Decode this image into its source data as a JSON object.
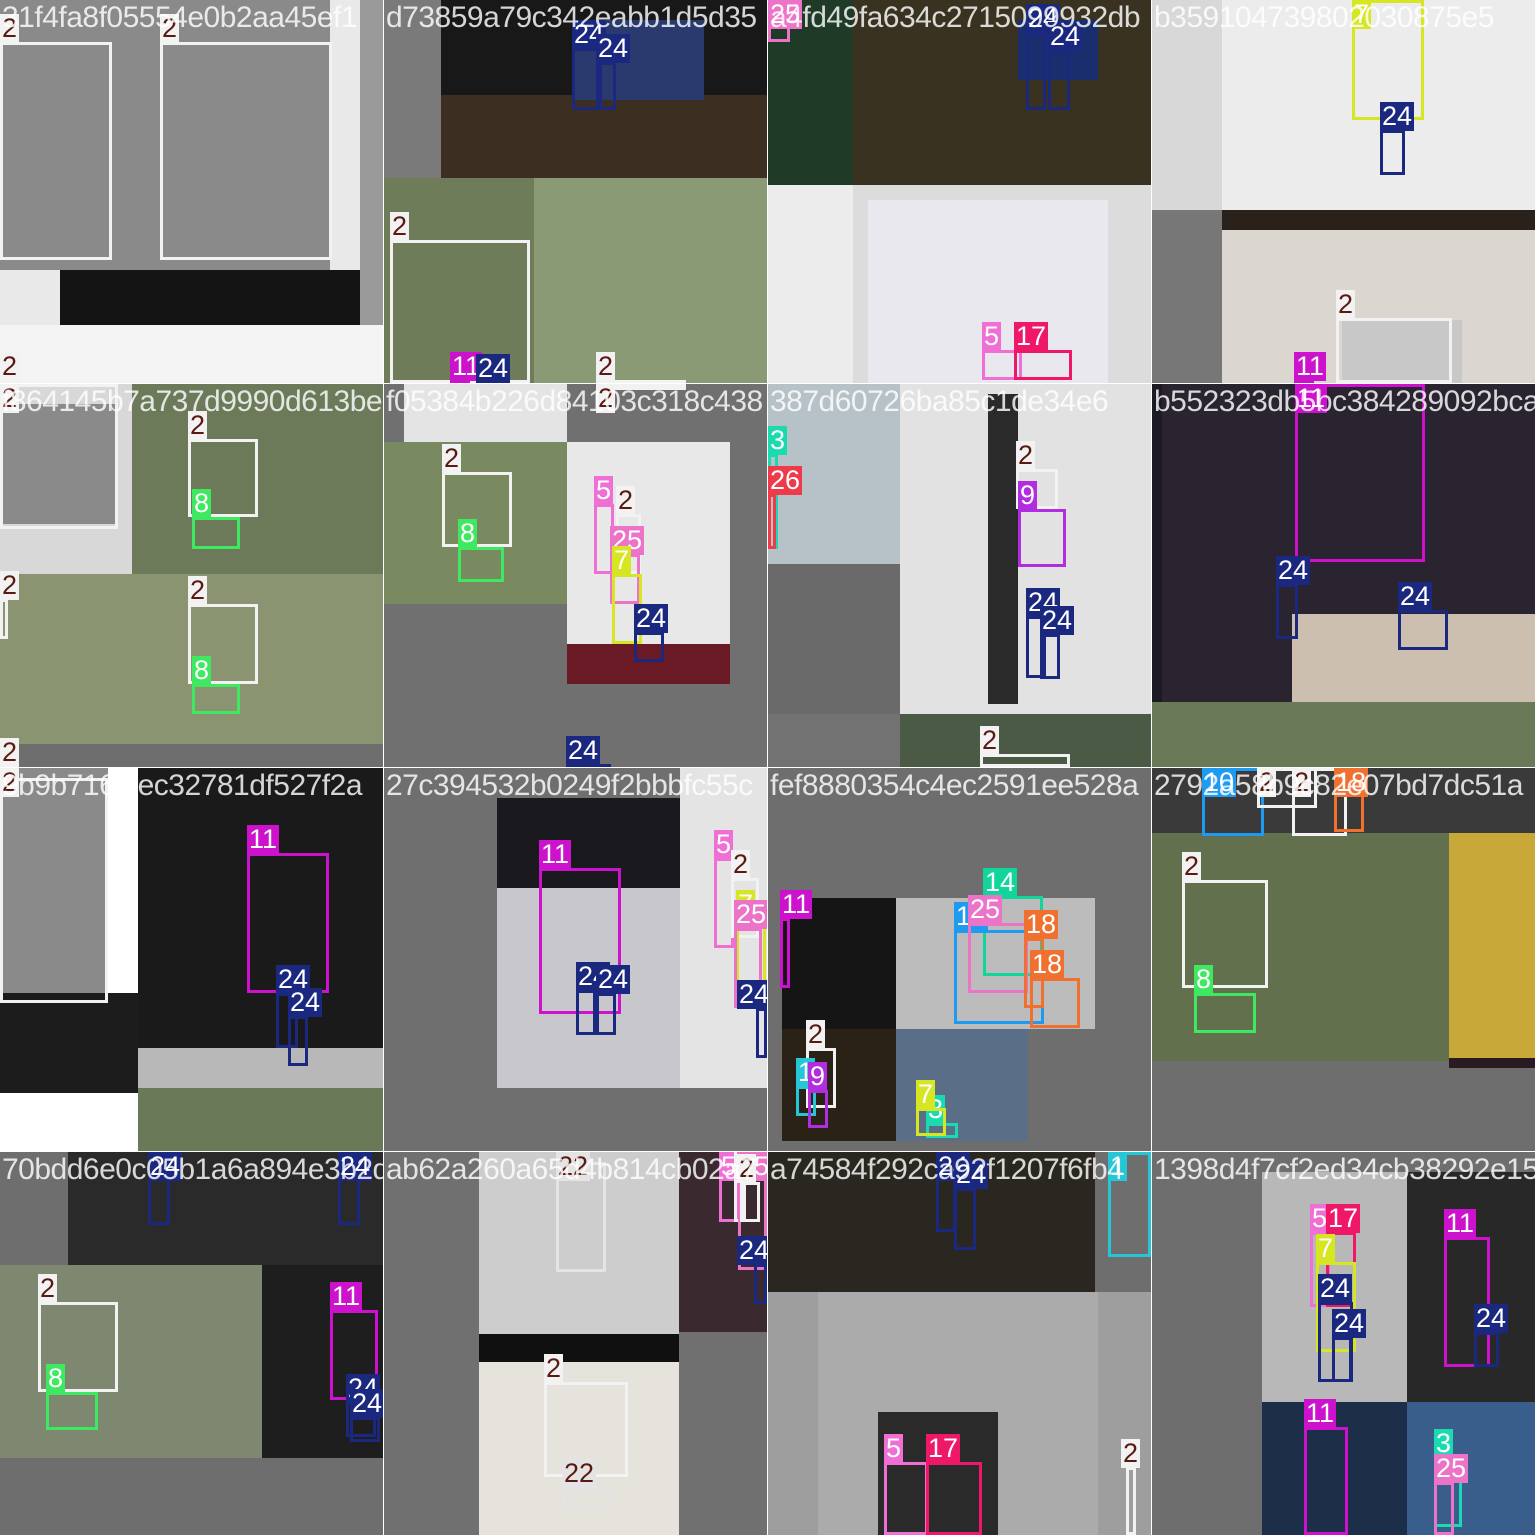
{
  "colors": {
    "1": "#25c7d6",
    "2": "#f2f2f2",
    "3": "#1adbb0",
    "5": "#f06fd5",
    "7": "#d6e622",
    "8": "#3ee860",
    "9": "#b02ee0",
    "10": "#1e9af0",
    "11": "#cc12cc",
    "14": "#10d69b",
    "17": "#ef1768",
    "18": "#f07030",
    "22": "#e4e4e4",
    "24": "#1b2880",
    "25": "#ec74c8",
    "26": "#ef3a4a"
  },
  "tiles": [
    {
      "filename": "31f4fa8f05554e0b2aa45ef1",
      "regions": [
        [
          0,
          0,
          360,
          325,
          "#e9e9e9"
        ],
        [
          360,
          0,
          23,
          383,
          "#9a9a9a"
        ],
        [
          0,
          325,
          383,
          58,
          "#f4f4f4"
        ],
        [
          0,
          0,
          330,
          270,
          "#8a8a8a"
        ],
        [
          60,
          270,
          300,
          55,
          "#141414"
        ]
      ],
      "boxes": [
        [
          "2",
          0,
          42,
          112,
          218
        ],
        [
          "2",
          160,
          42,
          172,
          218
        ],
        [
          "2",
          0,
          380,
          40,
          3
        ]
      ]
    },
    {
      "filename": "d73859a79c342eabb1d5d35",
      "regions": [
        [
          0,
          0,
          383,
          178,
          "#181818"
        ],
        [
          57,
          95,
          326,
          83,
          "#3c2e20"
        ],
        [
          190,
          20,
          130,
          80,
          "#2a3a6e"
        ],
        [
          0,
          178,
          383,
          205,
          "#6e7c5a"
        ],
        [
          150,
          178,
          233,
          205,
          "#8a9a74"
        ],
        [
          0,
          0,
          57,
          178,
          "#7a7a7a"
        ]
      ],
      "boxes": [
        [
          "24",
          188,
          48,
          30,
          62
        ],
        [
          "24",
          212,
          62,
          20,
          48
        ],
        [
          "2",
          6,
          240,
          140,
          143
        ],
        [
          "11",
          66,
          380,
          20,
          3
        ],
        [
          "24",
          92,
          395,
          20,
          3
        ],
        [
          "2",
          212,
          380,
          90,
          3
        ]
      ]
    },
    {
      "filename": "a4fd49fa634c2715099932db",
      "regions": [
        [
          0,
          0,
          85,
          185,
          "#203a28"
        ],
        [
          85,
          0,
          298,
          185,
          "#3a3220"
        ],
        [
          250,
          20,
          80,
          60,
          "#1a2e6e"
        ],
        [
          0,
          185,
          383,
          198,
          "#dcdcdc"
        ],
        [
          0,
          185,
          85,
          198,
          "#ececec"
        ],
        [
          100,
          200,
          240,
          183,
          "#e8e8ee"
        ]
      ],
      "boxes": [
        [
          "25",
          0,
          0,
          22,
          42
        ],
        [
          "24",
          258,
          32,
          20,
          78
        ],
        [
          "24",
          280,
          50,
          22,
          60
        ],
        [
          "5",
          214,
          350,
          40,
          30
        ],
        [
          "17",
          246,
          350,
          58,
          30
        ]
      ]
    },
    {
      "filename": "b359104739802030875e5",
      "regions": [
        [
          0,
          0,
          383,
          210,
          "#d8d8d8"
        ],
        [
          70,
          0,
          313,
          210,
          "#ececec"
        ],
        [
          0,
          210,
          383,
          173,
          "#2a221a"
        ],
        [
          70,
          230,
          313,
          153,
          "#dcd6d0"
        ],
        [
          0,
          210,
          70,
          173,
          "#777777"
        ],
        [
          190,
          320,
          120,
          63,
          "#c8c8c8"
        ]
      ],
      "boxes": [
        [
          "7",
          200,
          0,
          72,
          120
        ],
        [
          "24",
          228,
          130,
          25,
          45
        ],
        [
          "2",
          184,
          318,
          116,
          65
        ],
        [
          "11",
          142,
          380,
          20,
          3
        ]
      ]
    },
    {
      "filename": "f864145b7a737d9990d613be",
      "regions": [
        [
          0,
          0,
          132,
          190,
          "#d8d8d8"
        ],
        [
          0,
          20,
          118,
          120,
          "#8a8a8a"
        ],
        [
          132,
          0,
          251,
          190,
          "#6c7a5a"
        ],
        [
          0,
          190,
          383,
          193,
          "#8a9470"
        ],
        [
          0,
          360,
          383,
          23,
          "#6e6e6e"
        ]
      ],
      "boxes": [
        [
          "2",
          0,
          0,
          118,
          145
        ],
        [
          "2",
          188,
          55,
          70,
          78
        ],
        [
          "8",
          192,
          133,
          48,
          32
        ],
        [
          "2",
          0,
          215,
          8,
          40
        ],
        [
          "2",
          188,
          220,
          70,
          80
        ],
        [
          "8",
          192,
          300,
          48,
          30
        ],
        [
          "2",
          0,
          383,
          10,
          3
        ]
      ]
    },
    {
      "filename": "f05384b226d84103c318c438",
      "regions": [
        [
          0,
          0,
          383,
          383,
          "#707070"
        ],
        [
          20,
          0,
          163,
          60,
          "#e4e4e4"
        ],
        [
          0,
          58,
          183,
          162,
          "#7a8a60"
        ],
        [
          183,
          58,
          163,
          242,
          "#e8e8e8"
        ],
        [
          183,
          260,
          163,
          40,
          "#6a1a24"
        ]
      ],
      "boxes": [
        [
          "2",
          58,
          88,
          70,
          75
        ],
        [
          "8",
          74,
          163,
          46,
          35
        ],
        [
          "5",
          210,
          120,
          20,
          70
        ],
        [
          "2",
          232,
          130,
          25,
          60
        ],
        [
          "25",
          226,
          170,
          30,
          50
        ],
        [
          "7",
          228,
          190,
          30,
          70
        ],
        [
          "24",
          250,
          248,
          30,
          30
        ],
        [
          "2",
          212,
          0,
          90,
          3
        ],
        [
          "24",
          182,
          380,
          45,
          3
        ]
      ]
    },
    {
      "filename": "387d60726ba85c1de34e6",
      "regions": [
        [
          0,
          0,
          132,
          330,
          "#b6c2c8"
        ],
        [
          0,
          180,
          132,
          150,
          "#6a6a6a"
        ],
        [
          132,
          0,
          251,
          330,
          "#e2e2e2"
        ],
        [
          220,
          10,
          30,
          310,
          "#2a2a2a"
        ],
        [
          0,
          330,
          383,
          53,
          "#727272"
        ],
        [
          132,
          330,
          251,
          53,
          "#4a5a44"
        ]
      ],
      "boxes": [
        [
          "3",
          0,
          70,
          10,
          95
        ],
        [
          "26",
          0,
          110,
          8,
          55
        ],
        [
          "2",
          248,
          85,
          42,
          40
        ],
        [
          "9",
          250,
          125,
          48,
          58
        ],
        [
          "24",
          258,
          232,
          20,
          62
        ],
        [
          "24",
          272,
          250,
          20,
          45
        ],
        [
          "2",
          212,
          370,
          90,
          13
        ]
      ]
    },
    {
      "filename": "b552323db5bc384289092bca",
      "regions": [
        [
          0,
          0,
          383,
          318,
          "#1c1a22"
        ],
        [
          10,
          0,
          373,
          318,
          "#2a2430"
        ],
        [
          140,
          230,
          243,
          88,
          "#cdbfb0"
        ],
        [
          0,
          318,
          383,
          65,
          "#6a7a58"
        ]
      ],
      "boxes": [
        [
          "11",
          143,
          0,
          130,
          178
        ],
        [
          "24",
          124,
          200,
          22,
          55
        ],
        [
          "24",
          246,
          226,
          50,
          40
        ]
      ]
    },
    {
      "filename": "9b9b716fcec32781df527f2a",
      "regions": [
        [
          0,
          0,
          383,
          383,
          "#ffffff"
        ],
        [
          0,
          0,
          108,
          225,
          "#8a8a8a"
        ],
        [
          0,
          225,
          138,
          100,
          "#1c1c1c"
        ],
        [
          138,
          0,
          245,
          383,
          "#1a1a1a"
        ],
        [
          138,
          280,
          245,
          50,
          "#b8b8b8"
        ],
        [
          138,
          320,
          245,
          63,
          "#6a7a58"
        ]
      ],
      "boxes": [
        [
          "2",
          0,
          10,
          108,
          225
        ],
        [
          "11",
          247,
          85,
          82,
          140
        ],
        [
          "24",
          276,
          225,
          22,
          55
        ],
        [
          "24",
          288,
          248,
          20,
          50
        ]
      ]
    },
    {
      "filename": "27c394532b0249f2bbbfc55c",
      "regions": [
        [
          0,
          0,
          383,
          383,
          "#6f6f6f"
        ],
        [
          113,
          30,
          198,
          290,
          "#1a1a1e"
        ],
        [
          113,
          120,
          198,
          200,
          "#c8c8cc"
        ],
        [
          296,
          0,
          87,
          320,
          "#e4e4e4"
        ]
      ],
      "boxes": [
        [
          "11",
          155,
          100,
          82,
          146
        ],
        [
          "24",
          192,
          222,
          20,
          45
        ],
        [
          "24",
          212,
          225,
          20,
          42
        ],
        [
          "5",
          330,
          90,
          20,
          90
        ],
        [
          "2",
          347,
          110,
          28,
          60
        ],
        [
          "7",
          352,
          150,
          30,
          70
        ],
        [
          "25",
          350,
          160,
          28,
          80
        ],
        [
          "24",
          372,
          240,
          11,
          50
        ]
      ]
    },
    {
      "filename": "fef8880354c4ec2591ee528a",
      "regions": [
        [
          0,
          0,
          383,
          383,
          "#6e6e6e"
        ],
        [
          14,
          130,
          114,
          131,
          "#151515"
        ],
        [
          128,
          130,
          199,
          131,
          "#bcbcbc"
        ],
        [
          14,
          261,
          114,
          112,
          "#2a2216"
        ],
        [
          128,
          261,
          132,
          112,
          "#5a6e88"
        ]
      ],
      "boxes": [
        [
          "11",
          12,
          150,
          10,
          70
        ],
        [
          "14",
          215,
          128,
          60,
          80
        ],
        [
          "10",
          186,
          162,
          90,
          94
        ],
        [
          "25",
          200,
          155,
          60,
          70
        ],
        [
          "18",
          256,
          170,
          20,
          70
        ],
        [
          "18",
          262,
          210,
          50,
          50
        ],
        [
          "2",
          38,
          280,
          30,
          60
        ],
        [
          "1",
          28,
          318,
          20,
          30
        ],
        [
          "9",
          40,
          322,
          20,
          38
        ],
        [
          "3",
          158,
          355,
          32,
          15
        ],
        [
          "7",
          148,
          340,
          30,
          28
        ]
      ]
    },
    {
      "filename": "2792a58b9c82e07bd7dc51a",
      "regions": [
        [
          0,
          0,
          383,
          383,
          "#6e6e6e"
        ],
        [
          0,
          65,
          297,
          228,
          "#62704e"
        ],
        [
          297,
          0,
          86,
          300,
          "#2a1a22"
        ],
        [
          297,
          60,
          86,
          230,
          "#c8a838"
        ],
        [
          0,
          0,
          383,
          65,
          "#3a3a3a"
        ]
      ],
      "boxes": [
        [
          "10",
          50,
          0,
          62,
          68
        ],
        [
          "2",
          105,
          0,
          60,
          40
        ],
        [
          "2",
          140,
          0,
          55,
          68
        ],
        [
          "18",
          182,
          12,
          30,
          52
        ],
        [
          "2",
          30,
          112,
          86,
          108
        ],
        [
          "8",
          42,
          225,
          62,
          40
        ]
      ]
    },
    {
      "filename": "70bdd6e0c05b1a6a894e3b2d",
      "regions": [
        [
          0,
          0,
          383,
          383,
          "#6e6e6e"
        ],
        [
          68,
          0,
          315,
          113,
          "#2a2a2a"
        ],
        [
          0,
          113,
          262,
          193,
          "#7e8870"
        ],
        [
          262,
          113,
          121,
          193,
          "#1e1e1e"
        ]
      ],
      "boxes": [
        [
          "24",
          148,
          25,
          22,
          48
        ],
        [
          "24",
          338,
          25,
          22,
          48
        ],
        [
          "2",
          38,
          150,
          80,
          90
        ],
        [
          "8",
          46,
          240,
          52,
          38
        ],
        [
          "11",
          330,
          158,
          48,
          90
        ],
        [
          "24",
          346,
          250,
          30,
          35
        ],
        [
          "24",
          350,
          265,
          30,
          25
        ]
      ]
    },
    {
      "filename": "ab62a260a65d4b814cb02a7",
      "regions": [
        [
          0,
          0,
          383,
          383,
          "#707070"
        ],
        [
          95,
          0,
          200,
          182,
          "#cdcdcd"
        ],
        [
          95,
          182,
          200,
          201,
          "#101010"
        ],
        [
          95,
          210,
          200,
          173,
          "#e6e2dc"
        ],
        [
          295,
          0,
          88,
          180,
          "#3a2a30"
        ]
      ],
      "boxes": [
        [
          "22",
          172,
          10,
          50,
          110
        ],
        [
          "5",
          335,
          0,
          20,
          70
        ],
        [
          "2",
          350,
          0,
          12,
          70
        ],
        [
          "25",
          354,
          0,
          29,
          118
        ],
        [
          "2",
          356,
          30,
          20,
          40
        ],
        [
          "24",
          370,
          112,
          13,
          40
        ],
        [
          "2",
          160,
          230,
          84,
          95
        ],
        [
          "22",
          178,
          335,
          50,
          20
        ]
      ]
    },
    {
      "filename": "a74584f292ca92f1207f6fb4",
      "regions": [
        [
          0,
          0,
          327,
          140,
          "#2a2620"
        ],
        [
          327,
          0,
          56,
          383,
          "#6e6e6e"
        ],
        [
          0,
          140,
          383,
          243,
          "#9e9e9e"
        ],
        [
          50,
          140,
          280,
          243,
          "#ababab"
        ],
        [
          110,
          260,
          120,
          123,
          "#2a2a2a"
        ]
      ],
      "boxes": [
        [
          "1",
          340,
          0,
          43,
          105
        ],
        [
          "24",
          168,
          10,
          20,
          70
        ],
        [
          "24",
          186,
          36,
          22,
          62
        ],
        [
          "5",
          116,
          310,
          44,
          73
        ],
        [
          "17",
          158,
          310,
          56,
          73
        ],
        [
          "2",
          358,
          315,
          10,
          68
        ]
      ]
    },
    {
      "filename": "1398d4f7cf2ed34cb38292e15",
      "regions": [
        [
          0,
          0,
          383,
          383,
          "#6e6e6e"
        ],
        [
          110,
          20,
          145,
          230,
          "#b8b8b8"
        ],
        [
          255,
          20,
          128,
          230,
          "#282828"
        ],
        [
          110,
          250,
          273,
          133,
          "#1c2e48"
        ],
        [
          255,
          250,
          128,
          133,
          "#3a5e8c"
        ]
      ],
      "boxes": [
        [
          "5",
          158,
          80,
          20,
          75
        ],
        [
          "17",
          174,
          80,
          30,
          75
        ],
        [
          "7",
          164,
          110,
          40,
          90
        ],
        [
          "24",
          166,
          150,
          35,
          80
        ],
        [
          "24",
          180,
          185,
          20,
          45
        ],
        [
          "11",
          292,
          85,
          46,
          130
        ],
        [
          "24",
          322,
          180,
          25,
          35
        ],
        [
          "11",
          152,
          275,
          44,
          108
        ],
        [
          "3",
          282,
          305,
          28,
          70
        ],
        [
          "25",
          282,
          330,
          20,
          53
        ]
      ]
    }
  ]
}
